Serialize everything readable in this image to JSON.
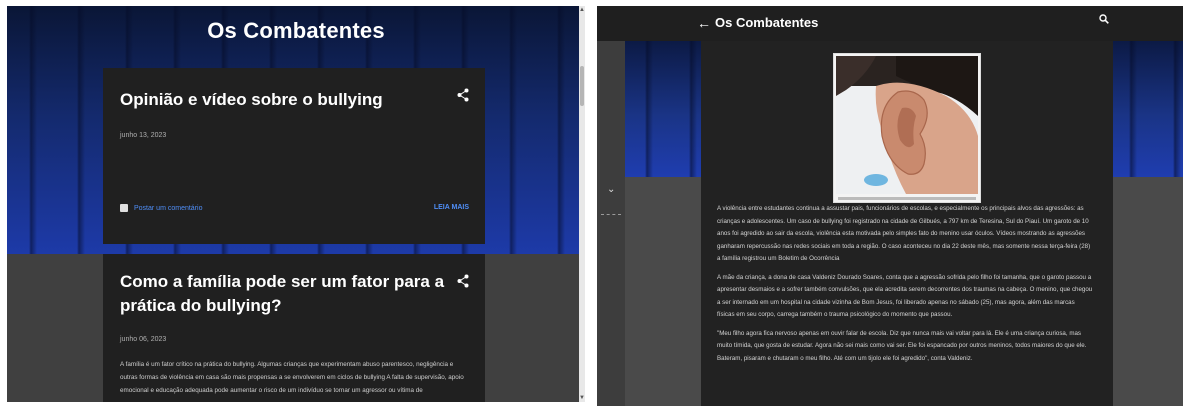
{
  "blog": {
    "title": "Os Combatentes"
  },
  "posts": [
    {
      "title": "Opinião e vídeo sobre o bullying",
      "date": "junho 13, 2023",
      "comment_label": "Postar um comentário",
      "read_more": "LEIA MAIS"
    },
    {
      "title": "Como a família pode ser um fator para a prática do bullying?",
      "date": "junho 06, 2023",
      "excerpt": " A família é um fator crítico na prática do bullying. Algumas crianças que experimentam abuso parentesco, negligência e outras formas de violência em casa são mais propensas a se envolverem em ciclos de bullying A falta de supervisão, apoio emocional e educação adequada pode aumentar o risco de um indivíduo se tornar um agressor ou vítima de"
    }
  ],
  "article_view": {
    "title": "Os Combatentes",
    "paragraphs": [
      "A violência entre estudantes continua a assustar pais, funcionários de escolas, e especialmente os principais alvos das agressões: as crianças e adolescentes. Um caso de bullying foi registrado na cidade de Gilbués, a 797 km de Teresina, Sul do Piauí. Um garoto de 10 anos foi agredido ao sair da escola, violência esta motivada pelo simples fato do menino usar óculos. Vídeos mostrando as agressões ganharam repercussão nas redes sociais em toda a região. O caso aconteceu no dia 22 deste mês, mas somente nessa terça-feira (28) a família registrou um Boletim de Ocorrência",
      "A mãe da criança, a dona de casa Valdeniz Dourado Soares, conta que a agressão sofrida pelo filho foi tamanha, que o garoto passou a apresentar desmaios e a sofrer também convulsões, que ela acredita serem decorrentes dos traumas na cabeça. O menino, que chegou a ser internado em um hospital na cidade vizinha de Bom Jesus, foi liberado apenas no sábado (25), mas agora, além das marcas físicas em seu corpo, carrega também o trauma psicológico do momento que passou.",
      "\"Meu filho agora fica nervoso apenas em ouvir falar de escola. Diz que nunca mais vai voltar para lá. Ele é uma criança curiosa, mas muito tímida, que gosta de estudar. Agora não sei mais como vai ser. Ele foi espancado por outros meninos, todos maiores do que ele. Bateram, pisaram e chutaram o meu filho. Até com um tijolo ele foi agredido\", conta Valdeniz."
    ]
  },
  "colors": {
    "link": "#4f8ef7",
    "card": "#202020",
    "topbar": "#1f1f1f"
  }
}
